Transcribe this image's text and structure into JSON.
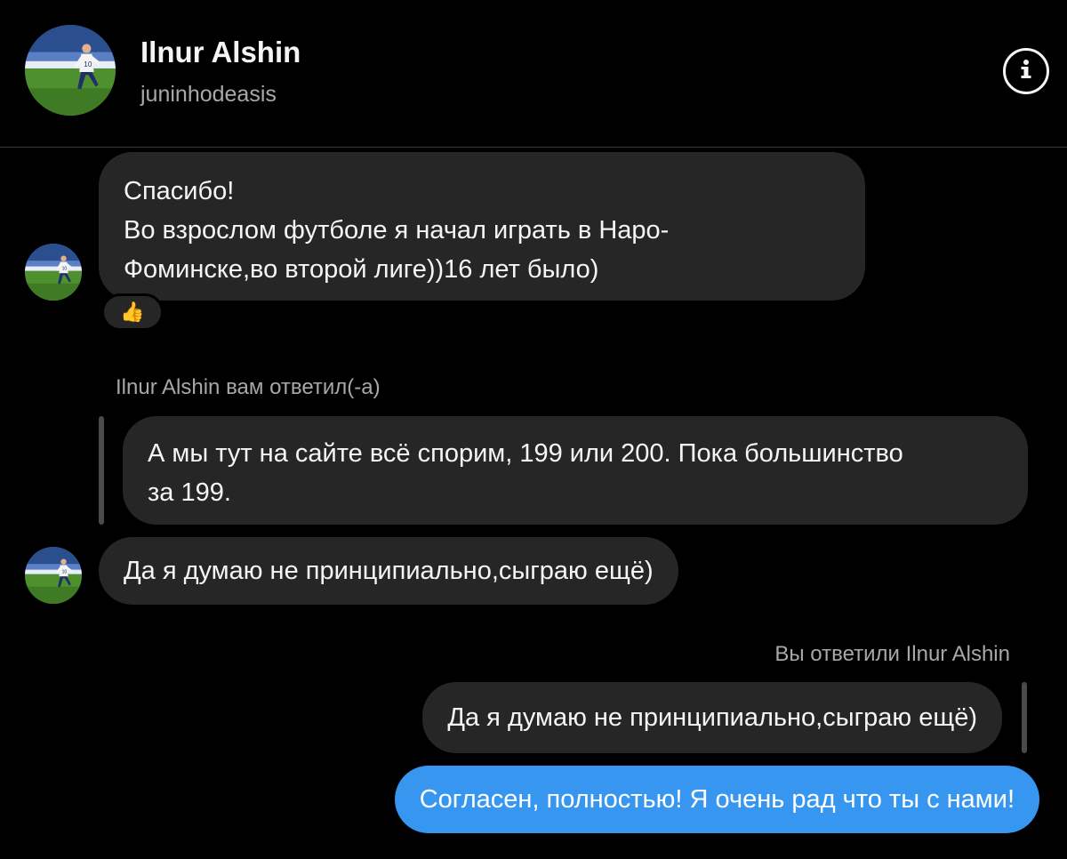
{
  "header": {
    "name": "Ilnur Alshin",
    "username": "juninhodeasis",
    "info_icon": "info-icon"
  },
  "messages": {
    "m1_lines": [
      "Спасибо!",
      "Во взрослом футболе я начал играть в Наро-",
      "Фоминске,во второй лиге))16 лет было)"
    ],
    "m1_reaction": "👍",
    "reply1_label": "Ilnur Alshin вам ответил(-а)",
    "reply1_quote_lines": [
      "А мы тут на сайте всё спорим, 199 или 200. Пока большинство",
      "за 199."
    ],
    "m2": "Да я думаю не принципиально,сыграю ещё)",
    "reply2_label": "Вы ответили Ilnur Alshin",
    "reply2_quote": "Да я думаю не принципиально,сыграю ещё)",
    "m3": "Согласен, полностью! Я очень рад что ты с нами!"
  },
  "colors": {
    "background": "#000000",
    "bubble_incoming": "#262626",
    "bubble_outgoing": "#3797f0",
    "secondary_text": "#a8a8a8"
  }
}
